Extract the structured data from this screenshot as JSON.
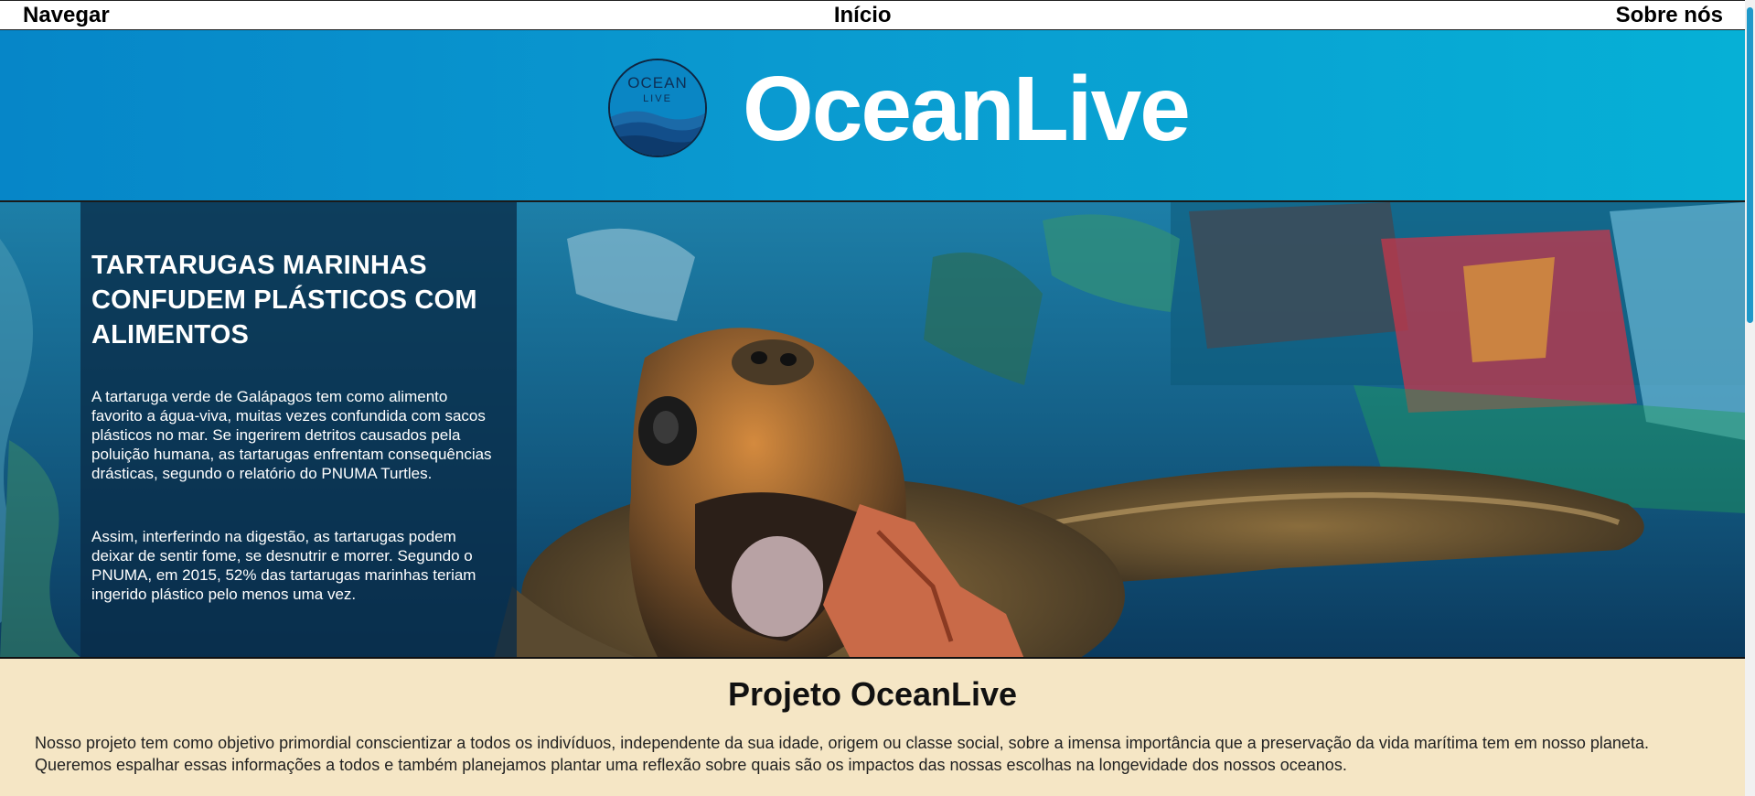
{
  "nav": {
    "left": "Navegar",
    "center": "Início",
    "right": "Sobre nós"
  },
  "header": {
    "brand": "OceanLive",
    "logo_top": "OCEAN",
    "logo_bottom": "LIVE"
  },
  "hero": {
    "title": "TARTARUGAS MARINHAS CONFUDEM PLÁSTICOS COM ALIMENTOS",
    "paragraph1": "A tartaruga verde de Galápagos tem como alimento favorito a água-viva, muitas vezes confundida com sacos plásticos no mar. Se ingerirem detritos causados pela poluição humana, as tartarugas enfrentam consequências drásticas, segundo o relatório do PNUMA Turtles.",
    "paragraph2": "Assim, interferindo na digestão, as tartarugas podem deixar de sentir fome, se desnutrir e morrer. Segundo o PNUMA, em 2015, 52% das tartarugas marinhas teriam ingerido plástico pelo menos uma vez."
  },
  "project": {
    "title": "Projeto OceanLive",
    "description": "Nosso projeto tem como objetivo primordial conscientizar a todos os indivíduos, independente da sua idade, origem ou classe social, sobre a imensa importância que a preservação da vida marítima tem em nosso planeta. Queremos espalhar essas informações a todos e também planejamos plantar uma reflexão sobre quais são os impactos das nossas escolhas na longevidade dos nossos oceanos."
  },
  "colors": {
    "header_start": "#0686c8",
    "header_end": "#06b0d6",
    "project_bg": "#f5e6c5",
    "scrollbar_thumb": "#1e98c9"
  }
}
